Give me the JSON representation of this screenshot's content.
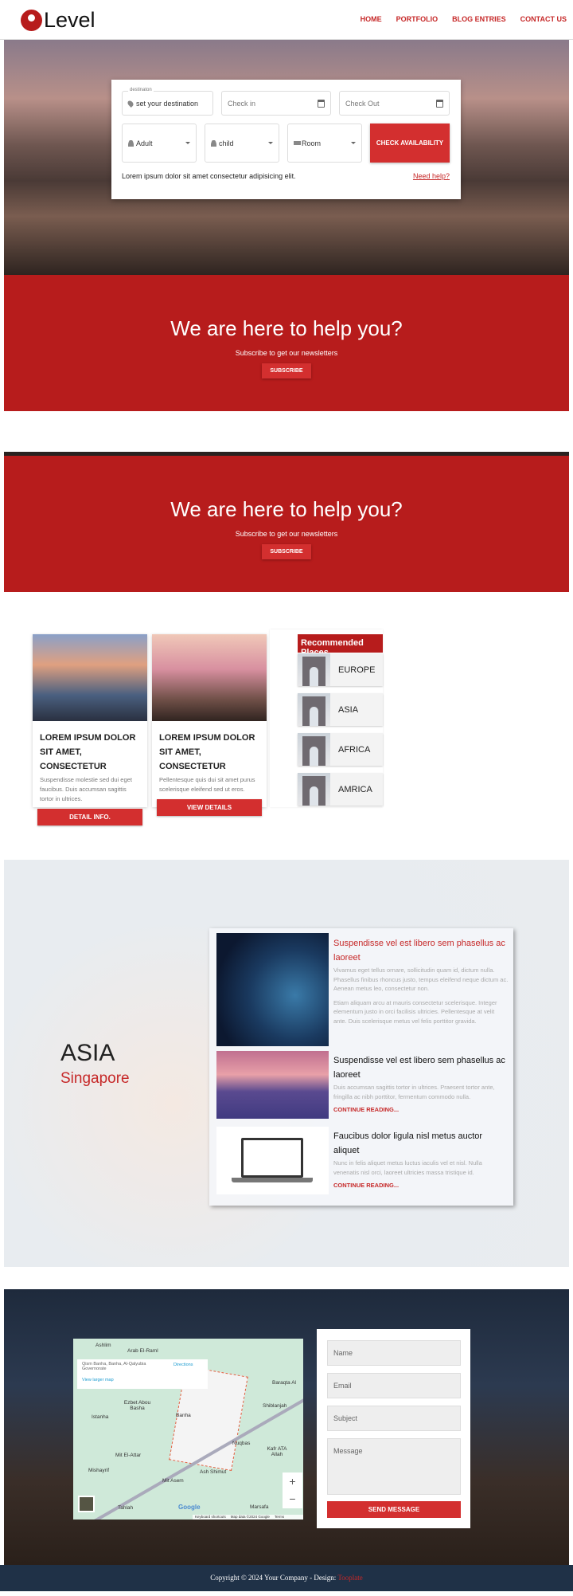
{
  "header": {
    "logo_text": "Level",
    "nav": [
      "HOME",
      "PORTFOLIO",
      "BLOG ENTRIES",
      "CONTACT US"
    ]
  },
  "booking": {
    "destination_label": "destinaton",
    "destination_value": "set your destination",
    "checkin_placeholder": "Check in",
    "checkout_placeholder": "Check Out",
    "adult": "Adult",
    "child": "child",
    "room": "Room",
    "check_button": "CHECK AVAILABILITY",
    "note": "Lorem ipsum dolor sit amet consectetur adipisicing elit.",
    "help_link": "Need help?"
  },
  "newsletter": {
    "title": "We are here to help you?",
    "subtitle": "Subscribe to get our newsletters",
    "button": "SUBSCRIBE"
  },
  "cards": [
    {
      "title": "LOREM IPSUM DOLOR SIT AMET, CONSECTETUR",
      "text": "Suspendisse molestie sed dui eget faucibus. Duis accumsan sagittis tortor in ultrices.",
      "button": "DETAIL INFO."
    },
    {
      "title": "LOREM IPSUM DOLOR SIT AMET, CONSECTETUR",
      "text": "Pellentesque quis dui sit amet purus scelerisque eleifend sed ut eros.",
      "button": "VIEW DETAILS"
    }
  ],
  "recommended": {
    "title": "Recommended Places",
    "items": [
      "EUROPE",
      "ASIA",
      "AFRICA",
      "AMRICA"
    ]
  },
  "region": {
    "title": "ASIA",
    "subtitle": "Singapore"
  },
  "blog": [
    {
      "title": "Suspendisse vel est libero sem phasellus ac laoreet",
      "text": "Vivamus eget tellus ornare, sollicitudin quam id, dictum nulla. Phasellus finibus rhoncus justo, tempus eleifend neque dictum ac. Aenean metus leo, consectetur non.",
      "text2": "Etiam aliquam arcu at mauris consectetur scelerisque. Integer elementum justo in orci facilisis ultricies. Pellentesque at velit ante. Duis scelerisque metus vel felis porttitor gravida."
    },
    {
      "title": "Suspendisse vel est libero sem phasellus ac laoreet",
      "text": "Duis accumsan sagittis tortor in ultrices. Praesent tortor ante, fringilla ac nibh porttitor, fermentum commodo nulla.",
      "link": "CONTINUE READING..."
    },
    {
      "title": "Faucibus dolor ligula nisl metus auctor aliquet",
      "text": "Nunc in felis aliquet metus luctus iaculis vel et nisl. Nulla venenatis nisl orci, laoreet ultricies massa tristique id.",
      "link": "CONTINUE READING..."
    }
  ],
  "map": {
    "place": "Qism Banha, Banha, Al-Qalyubia Governorate",
    "directions": "Directions",
    "larger": "View larger map",
    "labels": [
      "Ashlim",
      "Arab El-Raml",
      "Ezbet Abou Basha",
      "Istanha",
      "Banha",
      "Baraqta Al",
      "Shiblanjah",
      "Nuqbas",
      "Kafr ATA Allah",
      "Mit El-Attar",
      "Mishayrif",
      "Ash Shimut",
      "Mit Asem",
      "Tahlah",
      "Marsafa"
    ],
    "footer": [
      "Keyboard shortcuts",
      "Map data ©2024 Google",
      "Terms"
    ],
    "google": "Google",
    "zoom_in": "+",
    "zoom_out": "−"
  },
  "form": {
    "name": "Name",
    "email": "Email",
    "subject": "Subject",
    "message": "Message",
    "button": "SEND MESSAGE"
  },
  "footer": {
    "text": "Copyright © 2024 Your Company - Design: ",
    "link": "Tooplate"
  },
  "colors": {
    "accent": "#d32f2f",
    "dark_red": "#b71c1c",
    "footer": "#1f3147"
  }
}
